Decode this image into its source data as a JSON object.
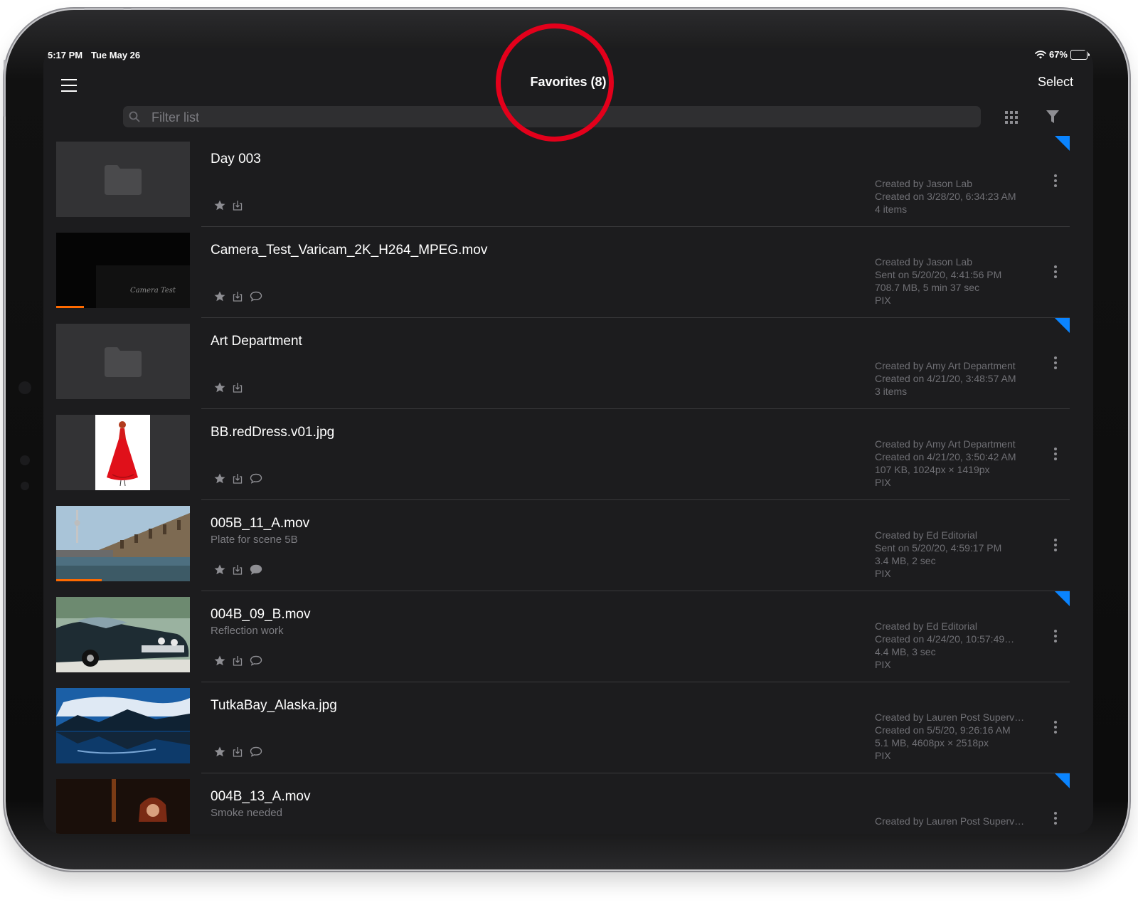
{
  "status_bar": {
    "time": "5:17 PM",
    "date": "Tue May 26",
    "battery": "67%",
    "battery_level": 0.67
  },
  "nav": {
    "title": "Favorites (8)",
    "select_label": "Select"
  },
  "search": {
    "placeholder": "Filter list",
    "value": ""
  },
  "accent_colors": {
    "flag": "#0a84ff",
    "progress": "#ff6a00",
    "highlight": "#e3001b"
  },
  "items": [
    {
      "title": "Day 003",
      "subtitle": "",
      "thumb": "folder",
      "flagged": true,
      "comment": "none",
      "meta": [
        "Created by Jason Lab",
        "Created on 3/28/20, 6:34:23 AM",
        "4 items"
      ]
    },
    {
      "title": "Camera_Test_Varicam_2K_H264_MPEG.mov",
      "subtitle": "",
      "thumb": "camera-test",
      "flagged": false,
      "comment": "outline",
      "progress": 0.21,
      "thumb_caption": "Camera Test",
      "meta": [
        "Created by Jason Lab",
        "Sent on 5/20/20, 4:41:56 PM",
        "708.7 MB, 5 min 37 sec",
        "PIX"
      ]
    },
    {
      "title": "Art Department",
      "subtitle": "",
      "thumb": "folder",
      "flagged": true,
      "comment": "none",
      "meta": [
        "Created by Amy Art Department",
        "Created on 4/21/20, 3:48:57 AM",
        "3 items"
      ]
    },
    {
      "title": "BB.redDress.v01.jpg",
      "subtitle": "",
      "thumb": "red-dress",
      "flagged": false,
      "comment": "outline",
      "meta": [
        "Created by Amy Art Department",
        "Created on 4/21/20, 3:50:42 AM",
        "107 KB, 1024px × 1419px",
        "PIX"
      ]
    },
    {
      "title": "005B_11_A.mov",
      "subtitle": "Plate for scene 5B",
      "thumb": "building",
      "flagged": false,
      "comment": "filled",
      "progress": 0.34,
      "meta": [
        "Created by Ed Editorial",
        "Sent on 5/20/20, 4:59:17 PM",
        "3.4 MB, 2 sec",
        "PIX"
      ]
    },
    {
      "title": "004B_09_B.mov",
      "subtitle": "Reflection work",
      "thumb": "car",
      "flagged": true,
      "comment": "outline",
      "meta": [
        "Created by Ed Editorial",
        "Created on 4/24/20, 10:57:49…",
        "4.4 MB, 3 sec",
        "PIX"
      ]
    },
    {
      "title": "TutkaBay_Alaska.jpg",
      "subtitle": "",
      "thumb": "lake",
      "flagged": false,
      "comment": "outline",
      "meta": [
        "Created by Lauren Post Superv…",
        "Created on 5/5/20, 9:26:16 AM",
        "5.1 MB, 4608px × 2518px",
        "PIX"
      ]
    },
    {
      "title": "004B_13_A.mov",
      "subtitle": "Smoke needed",
      "thumb": "portrait",
      "flagged": true,
      "comment": "outline",
      "meta": [
        "Created by Lauren Post Superv…"
      ]
    }
  ]
}
